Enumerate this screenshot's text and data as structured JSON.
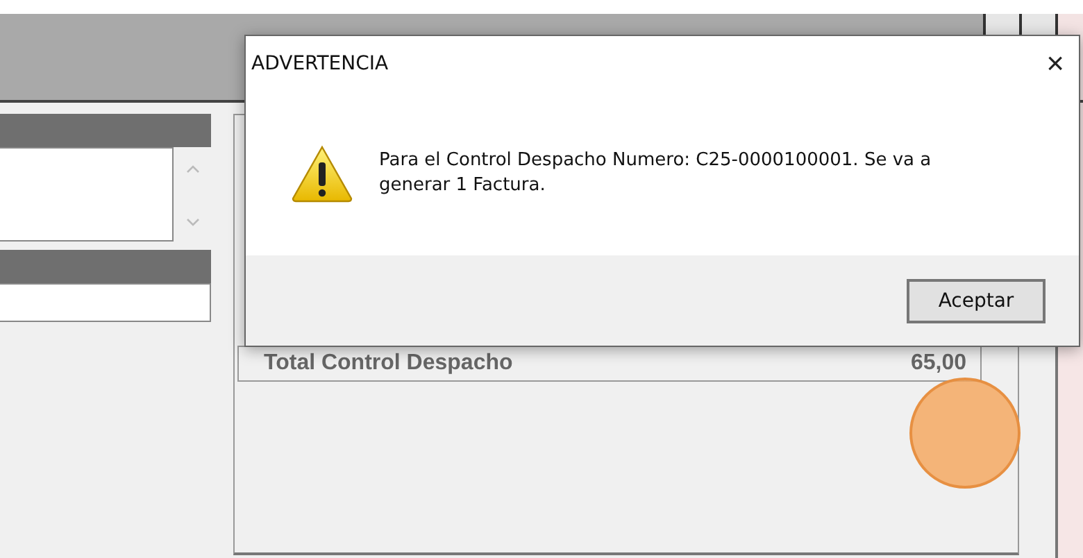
{
  "dialog": {
    "title": "ADVERTENCIA",
    "close": "×",
    "message": "Para el Control Despacho Numero: C25-0000100001. Se va a generar 1 Factura.",
    "buttons": [
      "Aceptar"
    ]
  },
  "background": {
    "total_label": "Total Control Despacho",
    "total_value": "65,00"
  }
}
